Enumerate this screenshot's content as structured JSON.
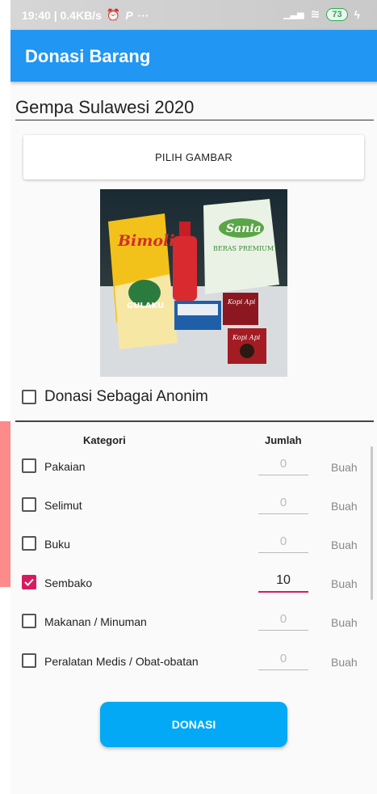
{
  "statusbar": {
    "left_text": "19:40 | 0.4KB/s",
    "right_battery": "73"
  },
  "appbar": {
    "title": "Donasi Barang"
  },
  "form": {
    "event_name": "Gempa Sulawesi 2020",
    "pick_image_label": "PILIH GAMBAR",
    "anonymous_label": "Donasi Sebagai Anonim",
    "anonymous_checked": false
  },
  "table": {
    "header_category": "Kategori",
    "header_amount": "Jumlah",
    "rows": [
      {
        "label": "Pakaian",
        "qty": "0",
        "unit": "Buah",
        "checked": false
      },
      {
        "label": "Selimut",
        "qty": "0",
        "unit": "Buah",
        "checked": false
      },
      {
        "label": "Buku",
        "qty": "0",
        "unit": "Buah",
        "checked": false
      },
      {
        "label": "Sembako",
        "qty": "10",
        "unit": "Buah",
        "checked": true
      },
      {
        "label": "Makanan / Minuman",
        "qty": "0",
        "unit": "Buah",
        "checked": false
      },
      {
        "label": "Peralatan Medis / Obat-obatan",
        "qty": "0",
        "unit": "Buah",
        "checked": false
      }
    ]
  },
  "donate_label": "DONASI",
  "photo_text": {
    "brand1": "Bimoli",
    "brand2": "Sania",
    "brand2_sub": "BERAS PREMIUM",
    "brand3": "GULAKU",
    "brand4": "Kopi Api"
  },
  "colors": {
    "appbar": "#2196f3",
    "accent": "#d81b60",
    "button": "#03a9f4"
  }
}
